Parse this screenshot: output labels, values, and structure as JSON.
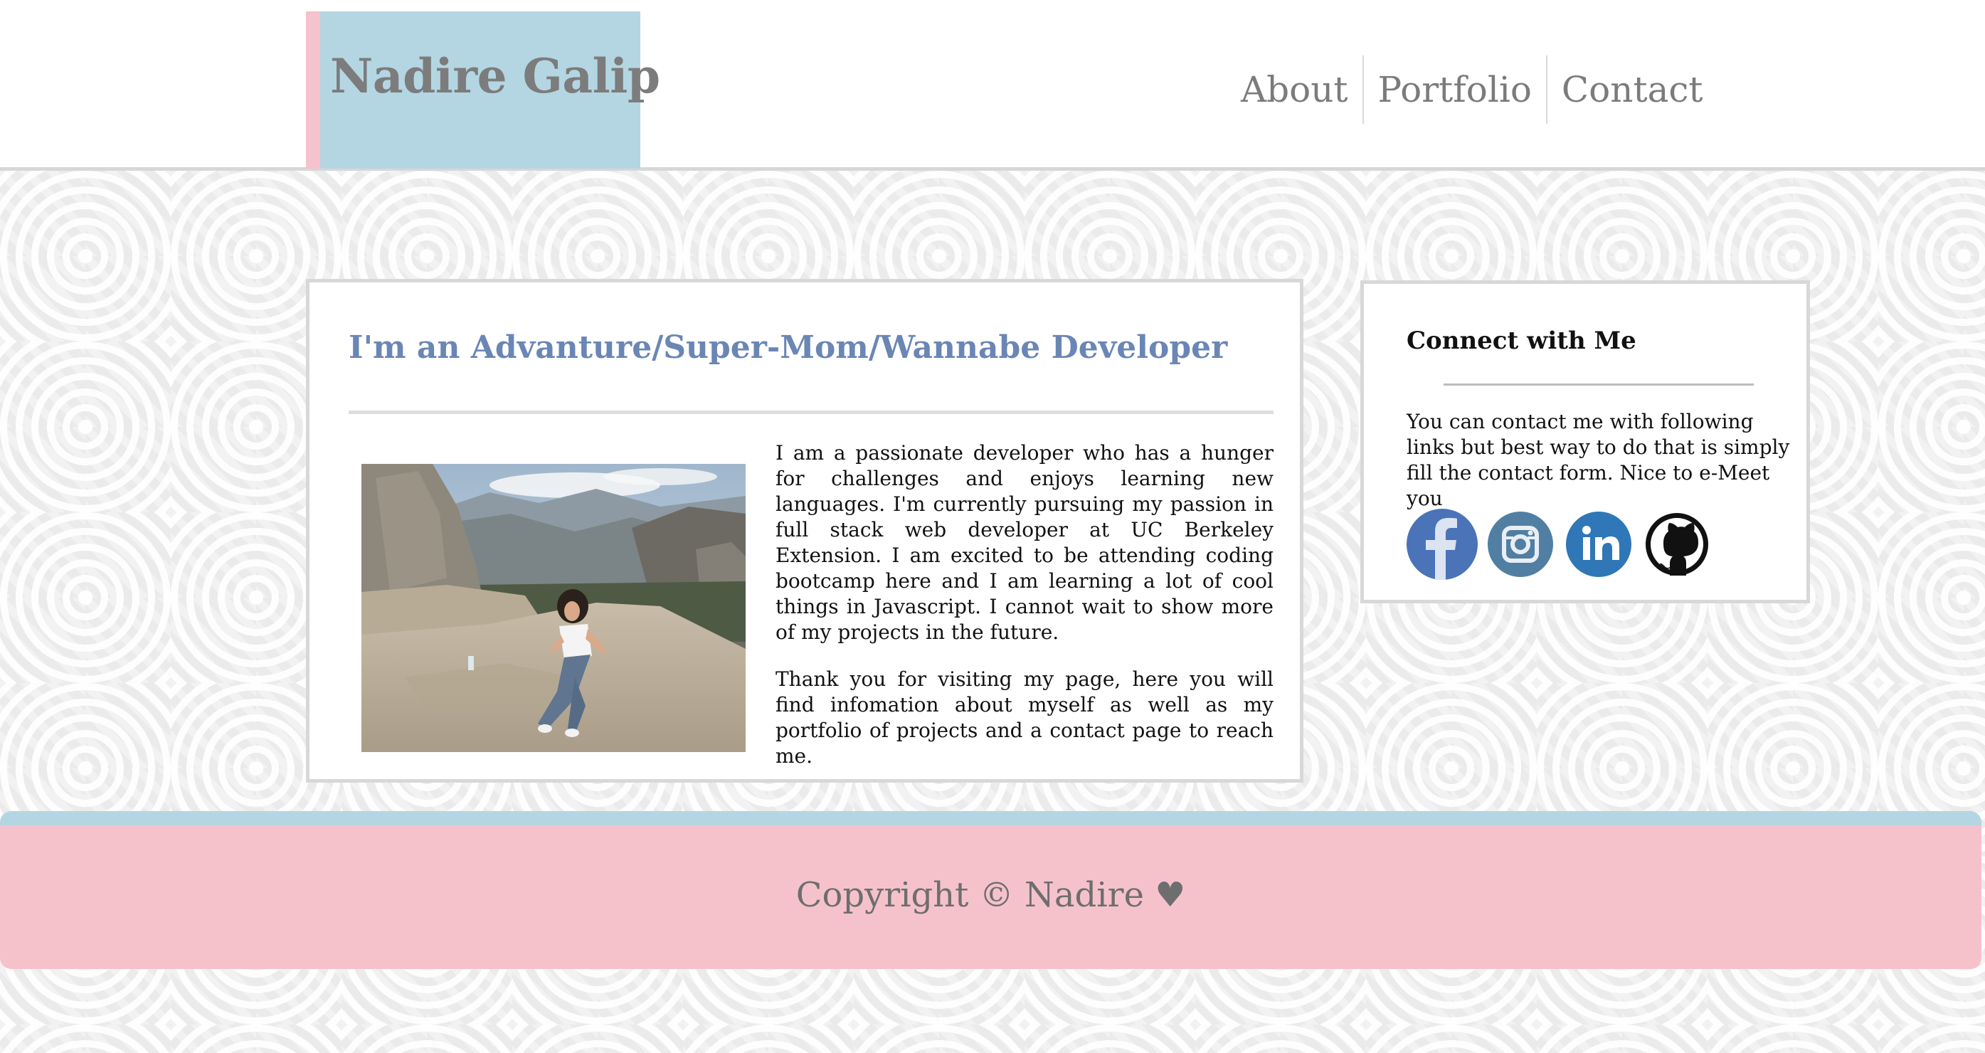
{
  "header": {
    "brand": "Nadire Galip",
    "nav": [
      {
        "label": "About"
      },
      {
        "label": "Portfolio"
      },
      {
        "label": "Contact"
      }
    ]
  },
  "about": {
    "title": "I'm an Advanture/Super-Mom/Wannabe Developer",
    "paragraphs": [
      "I am a passionate developer who has a hunger for challenges and enjoys learning new languages. I'm currently pursuing my passion in full stack web developer at UC Berkeley Extension. I am excited to be attending coding bootcamp here and I am learning a lot of cool things in Javascript. I cannot wait to show more of my projects in the future.",
      "Thank you for visiting my page, here you will find infomation about myself as well as my portfolio of projects and a contact page to reach me."
    ]
  },
  "connect": {
    "title": "Connect with Me",
    "text": "You can contact me with following links but best way to do that is simply fill the contact form. Nice to e-Meet you",
    "icons": [
      {
        "name": "facebook-icon",
        "color": "#4b73b8"
      },
      {
        "name": "instagram-icon",
        "color": "#517fa4"
      },
      {
        "name": "linkedin-icon",
        "color": "#2f77b6"
      },
      {
        "name": "github-icon",
        "color": "#111111"
      }
    ]
  },
  "footer": {
    "copyright": "Copyright © Nadire ♥"
  },
  "colors": {
    "brand_bg": "#b4d6e3",
    "accent_pink": "#f5c2cd",
    "title_blue": "#6a86b5",
    "text_gray": "#7b7b7b"
  }
}
